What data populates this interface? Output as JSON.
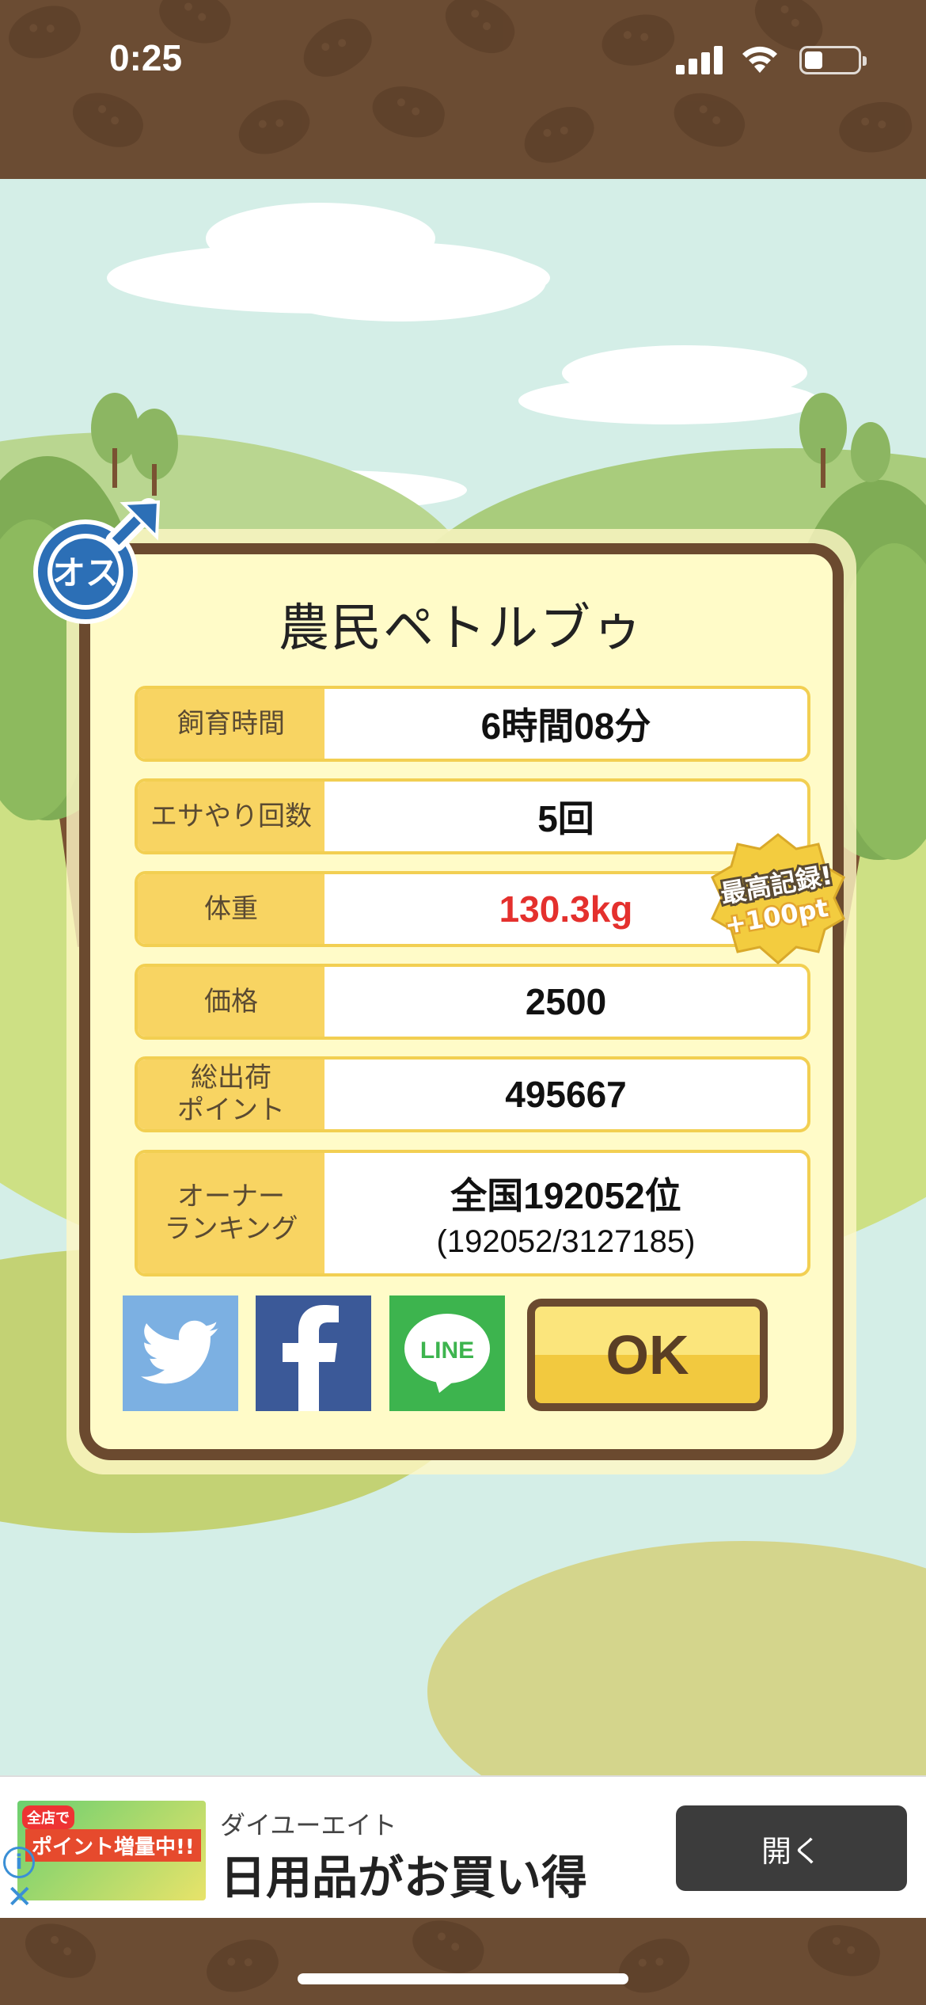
{
  "status_bar": {
    "time": "0:25"
  },
  "pet": {
    "name": "農民ペトルブゥ",
    "sex_label": "オス"
  },
  "stats": [
    {
      "label": "飼育時間",
      "value": "6時間08分"
    },
    {
      "label": "エサやり回数",
      "value": "5回"
    },
    {
      "label": "体重",
      "value": "130.3kg",
      "color": "#e4302d"
    },
    {
      "label": "価格",
      "value": "2500"
    },
    {
      "label": "総出荷\nポイント",
      "value": "495667"
    },
    {
      "label": "オーナー\nランキング",
      "value": "全国192052位",
      "sub": "(192052/3127185)"
    }
  ],
  "record_badge": {
    "line1": "最高記録!",
    "line2": "+100pt"
  },
  "share": {
    "twitter_icon": "twitter-bird-icon",
    "facebook_icon": "facebook-f-icon",
    "line_label": "LINE"
  },
  "ok_label": "OK",
  "ad": {
    "thumb_text_1": "全店で",
    "thumb_text_2": "ポイント増量中!!",
    "advertiser": "ダイユーエイト",
    "headline": "日用品がお買い得",
    "open_label": "開く",
    "info_symbol": "i",
    "close_symbol": "✕"
  },
  "colors": {
    "frame": "#6b4a2f",
    "panel": "#fffbc8",
    "label_bg": "#f8d462",
    "highlight": "#e4302d"
  }
}
